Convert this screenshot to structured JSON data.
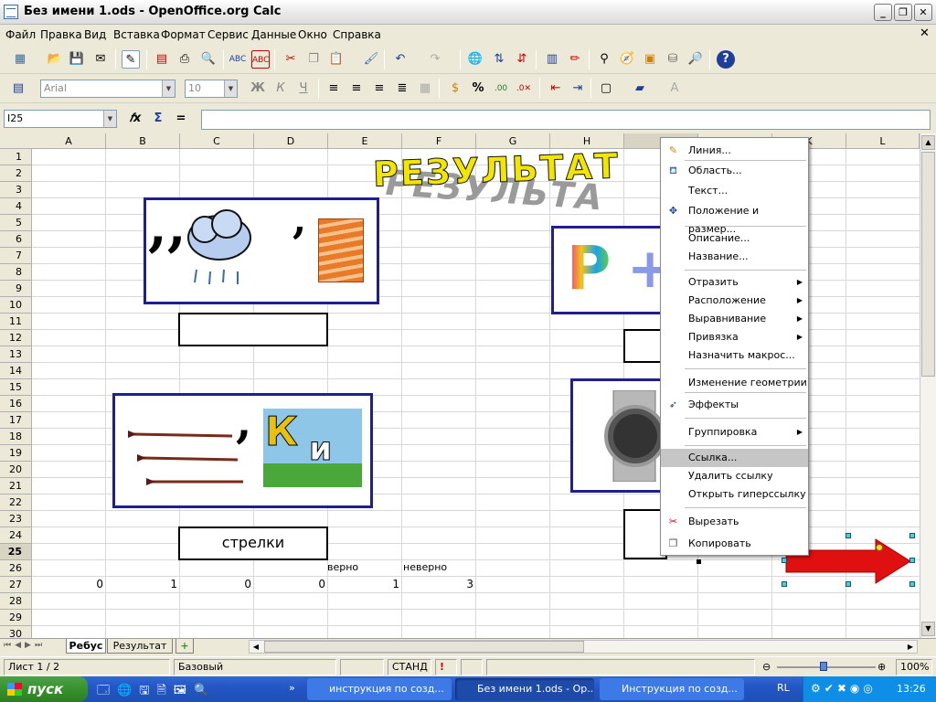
{
  "window": {
    "title": "Без имени 1.ods - OpenOffice.org Calc"
  },
  "menu": [
    "Файл",
    "Правка",
    "Вид",
    "Вставка",
    "Формат",
    "Сервис",
    "Данные",
    "Окно",
    "Справка"
  ],
  "format_toolbar": {
    "font_name": "Arial",
    "font_size": "10"
  },
  "formula_bar": {
    "cell_ref": "I25",
    "formula": ""
  },
  "columns": [
    "A",
    "B",
    "C",
    "D",
    "E",
    "F",
    "G",
    "H",
    "I",
    "J",
    "K",
    "L"
  ],
  "rows": [
    "1",
    "2",
    "3",
    "4",
    "5",
    "6",
    "7",
    "8",
    "9",
    "10",
    "11",
    "12",
    "13",
    "14",
    "15",
    "16",
    "17",
    "18",
    "19",
    "20",
    "21",
    "22",
    "23",
    "24",
    "25",
    "26",
    "27",
    "28",
    "29",
    "30"
  ],
  "cells": {
    "row26": {
      "E": "верно",
      "F": "неверно"
    },
    "row27": {
      "A": "0",
      "B": "1",
      "C": "0",
      "D": "0",
      "E": "1",
      "F": "3"
    }
  },
  "fontwork_title": "РЕЗУЛЬТАТ",
  "answer_box_label": "стрелки",
  "context_menu": [
    {
      "label": "Линия...",
      "icon": "line-icon"
    },
    {
      "label": "Область...",
      "icon": "paint-bucket-icon"
    },
    {
      "label": "Текст..."
    },
    {
      "label": "Положение и размер...",
      "icon": "position-size-icon"
    },
    {
      "label": "Описание..."
    },
    {
      "label": "Название..."
    },
    {
      "label": "Отразить",
      "submenu": true
    },
    {
      "label": "Расположение",
      "submenu": true
    },
    {
      "label": "Выравнивание",
      "submenu": true
    },
    {
      "label": "Привязка",
      "submenu": true
    },
    {
      "label": "Назначить макрос..."
    },
    {
      "label": "Изменение геометрии"
    },
    {
      "label": "Эффекты",
      "icon": "effects-icon"
    },
    {
      "label": "Группировка",
      "submenu": true
    },
    {
      "label": "Ссылка...",
      "highlighted": true
    },
    {
      "label": "Удалить ссылку"
    },
    {
      "label": "Открыть гиперссылку"
    },
    {
      "label": "Вырезать",
      "icon": "scissors-icon"
    },
    {
      "label": "Копировать",
      "icon": "copy-icon"
    }
  ],
  "sheet_tabs": [
    "Ребус",
    "Результат"
  ],
  "active_tab": "Ребус",
  "status": {
    "sheet": "Лист 1 / 2",
    "style": "Базовый",
    "mode": "СТАНД",
    "zoom": "100%"
  },
  "taskbar": {
    "start": "пуск",
    "tasks": [
      "инструкция по созд...",
      "Без имени 1.ods - Op...",
      "Инструкция по созд..."
    ],
    "lang": "RL",
    "time": "13:26"
  },
  "colors": {
    "frame": "#1f1f8f",
    "arrow": "#e11010",
    "title_yellow": "#f2e600",
    "menu_highlight": "#c6c6c6"
  }
}
